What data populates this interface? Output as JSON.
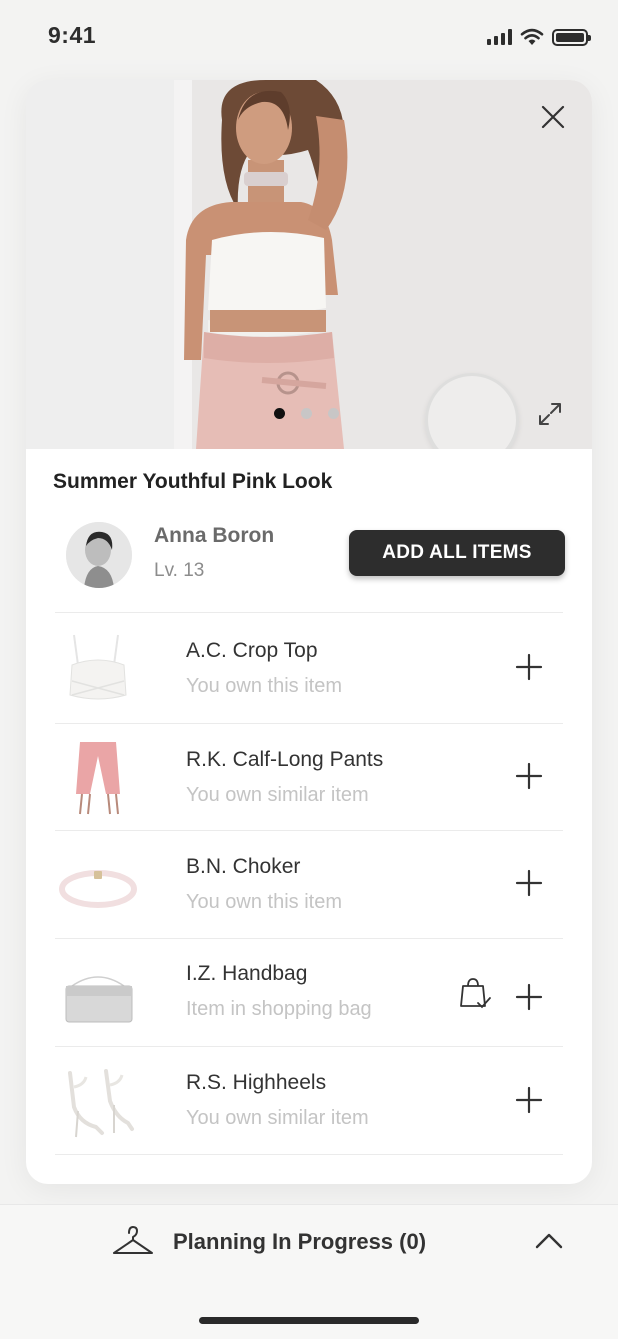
{
  "status_bar": {
    "time": "9:41"
  },
  "look": {
    "title": "Summer Youthful Pink Look",
    "carousel": {
      "slides": 3,
      "active_index": 0
    }
  },
  "creator": {
    "name": "Anna Boron",
    "level": "Lv. 13"
  },
  "actions": {
    "add_all_label": "ADD ALL ITEMS"
  },
  "items": [
    {
      "name": "A.C. Crop Top",
      "status": "You own this item",
      "icon": "crop-top"
    },
    {
      "name": "R.K. Calf-Long Pants",
      "status": "You own similar item",
      "icon": "pants"
    },
    {
      "name": "B.N. Choker",
      "status": "You own this item",
      "icon": "choker"
    },
    {
      "name": "I.Z. Handbag",
      "status": "Item in shopping bag",
      "icon": "handbag",
      "in_bag": true
    },
    {
      "name": "R.S. Highheels",
      "status": "You own similar item",
      "icon": "highheels"
    }
  ],
  "bottom_bar": {
    "label": "Planning In Progress (0)"
  },
  "colors": {
    "accent_dark": "#2d2d2d",
    "muted_text": "#c4c4c4",
    "pink": "#e8bdb8"
  }
}
